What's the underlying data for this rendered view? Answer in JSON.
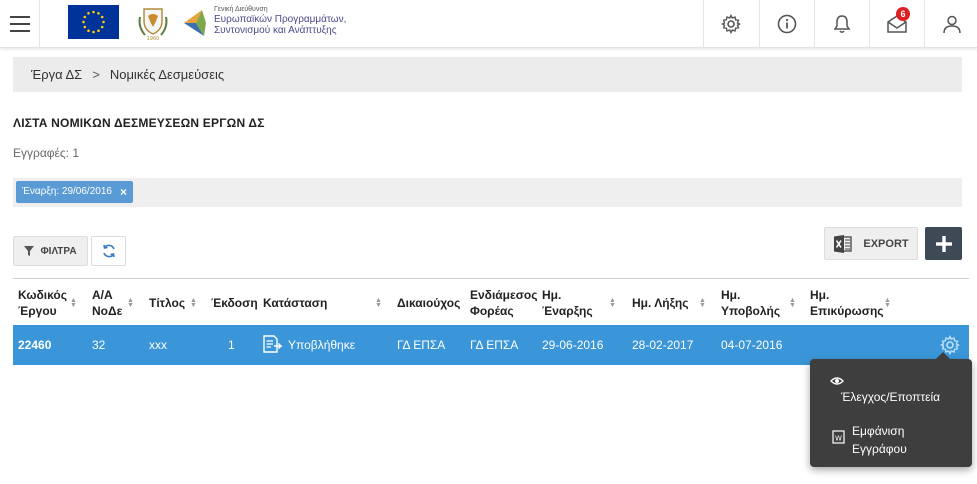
{
  "header": {
    "org_line1": "Γενική Διεύθυνση",
    "org_line2": "Ευρωπαϊκών Προγραμμάτων,",
    "org_line3": "Συντονισμού και Ανάπτυξης",
    "notification_count": "6",
    "icons": [
      "menu-icon",
      "gear-icon",
      "info-icon",
      "bell-icon",
      "mail-icon",
      "user-icon"
    ]
  },
  "breadcrumb": {
    "items": [
      "Έργα ΔΣ",
      "Νομικές Δεσμεύσεις"
    ],
    "separator": ">"
  },
  "page": {
    "title": "ΛΙΣΤΑ ΝΟΜΙΚΩΝ ΔΕΣΜΕΥΣΕΩΝ ΕΡΓΩΝ ΔΣ",
    "records": "Εγγραφές: 1"
  },
  "filters": {
    "active_chip": "Έναρξη: 29/06/2016",
    "chip_remove": "×"
  },
  "toolbar": {
    "filters_label": "ΦΙΛΤΡΑ",
    "export_label": "EXPORT"
  },
  "table": {
    "columns": [
      {
        "line1": "Κωδικός",
        "line2": "Έργου"
      },
      {
        "line1": "Α/Α",
        "line2": "ΝοΔε"
      },
      {
        "line1": "Τίτλος",
        "line2": ""
      },
      {
        "line1": "Έκδοση",
        "line2": ""
      },
      {
        "line1": "Κατάσταση",
        "line2": ""
      },
      {
        "line1": "Δικαιούχος",
        "line2": ""
      },
      {
        "line1": "Ενδιάμεσος",
        "line2": "Φορέας"
      },
      {
        "line1": "Ημ.",
        "line2": "Έναρξης"
      },
      {
        "line1": "Ημ. Λήξης",
        "line2": ""
      },
      {
        "line1": "Ημ.",
        "line2": "Υποβολής"
      },
      {
        "line1": "Ημ.",
        "line2": "Επικύρωσης"
      }
    ],
    "rows": [
      {
        "code": "22460",
        "aa": "32",
        "title": "xxx",
        "version": "1",
        "status": "Υποβλήθηκε",
        "beneficiary": "ΓΔ ΕΠΣΑ",
        "intermediate": "ΓΔ ΕΠΣΑ",
        "start": "29-06-2016",
        "end": "28-02-2017",
        "submitted": "04-07-2016",
        "ratified": ""
      }
    ]
  },
  "context_menu": {
    "items": [
      {
        "label": "Έλεγχος/Εποπτεία",
        "icon": "eye-icon"
      },
      {
        "label_line1": "Εμφάνιση",
        "label_line2": "Εγγράφου",
        "icon": "word-doc-icon"
      }
    ]
  },
  "colors": {
    "row_highlight": "#3a96d8",
    "chip": "#5b9bd5",
    "add_button": "#3d4a55",
    "menu_bg": "#3e3e3e",
    "badge": "#e02020"
  }
}
